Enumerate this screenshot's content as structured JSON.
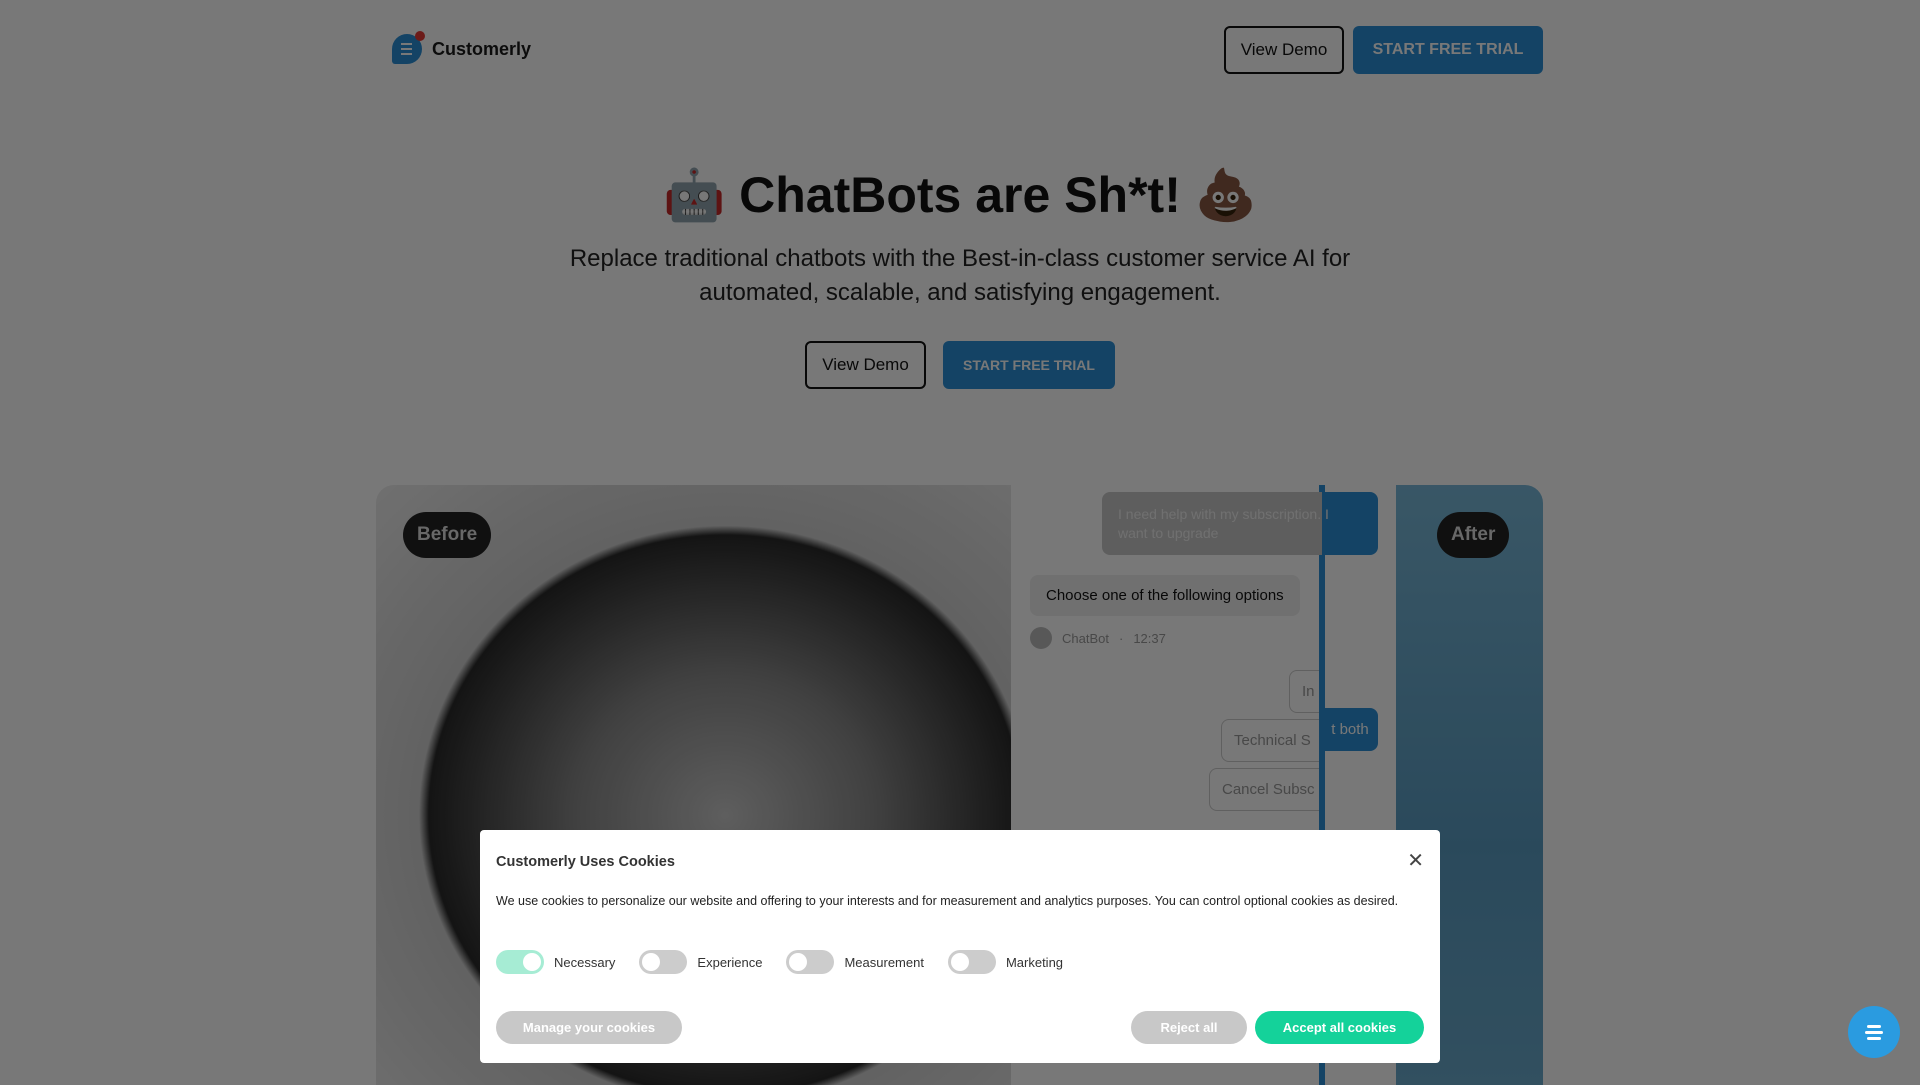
{
  "nav": {
    "brand": "Customerly",
    "view_demo": "View Demo",
    "start_trial": "START FREE TRIAL"
  },
  "hero": {
    "title": "🤖 ChatBots are Sh*t! 💩",
    "subtitle": "Replace traditional chatbots with the Best-in-class customer service AI for automated, scalable, and satisfying engagement.",
    "view_demo": "View Demo",
    "start_trial": "START FREE TRIAL"
  },
  "comparison": {
    "before": "Before",
    "after": "After",
    "user_message": "I need help with my subscription. I want to upgrade",
    "bot_message": "Choose one of the following options",
    "bot_name": "ChatBot",
    "bot_sep": "·",
    "bot_time": "12:37",
    "options": [
      "In",
      "Technical S",
      "Cancel Subsc"
    ],
    "after_reply_fragment": "t both"
  },
  "cookie": {
    "title": "Customerly Uses Cookies",
    "close": "✕",
    "text": "We use cookies to personalize our website and offering to your interests and for measurement and analytics purposes. You can control optional cookies as desired.",
    "toggles": [
      {
        "label": "Necessary",
        "on": true
      },
      {
        "label": "Experience",
        "on": false
      },
      {
        "label": "Measurement",
        "on": false
      },
      {
        "label": "Marketing",
        "on": false
      }
    ],
    "manage": "Manage your cookies",
    "reject": "Reject all",
    "accept": "Accept all cookies"
  },
  "colors": {
    "brand": "#2a8fd6",
    "accept": "#14d29a",
    "toggle_on": "#a6ecd4"
  },
  "widget": {
    "icon": "chat-icon"
  }
}
